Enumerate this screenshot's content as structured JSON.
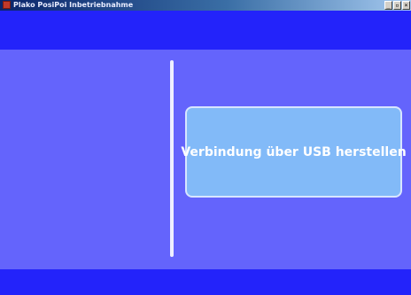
{
  "window": {
    "title": "Plako PosiPoi Inbetriebnahme",
    "minimize_glyph": "_",
    "restore_glyph": "▫",
    "close_glyph": "×"
  },
  "main": {
    "usb_button_label": "Verbindung über USB herstellen"
  },
  "colors": {
    "band": "#2323fa",
    "background": "#6464fc",
    "button": "#82baf8",
    "divider": "#eef0ff"
  }
}
